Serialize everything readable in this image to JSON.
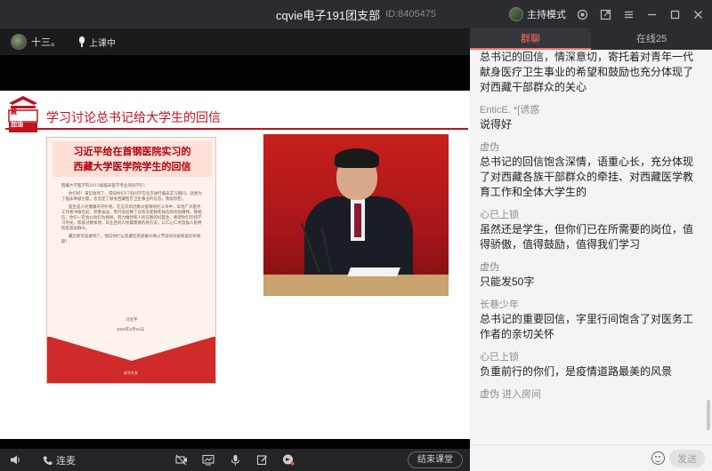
{
  "window": {
    "title": "cqvie电子191团支部",
    "room_id": "ID:8405475",
    "mode_label": "主持模式"
  },
  "stage": {
    "host_name": "十三。",
    "class_status": "上课中"
  },
  "slide": {
    "title": "学习讨论总书记给大学生的回信",
    "logo_text": "藏加油",
    "letter_heading_line1": "习近平给在首钢医院实习的",
    "letter_heading_line2": "西藏大学医学院学生的回信",
    "letter_salutation": "西藏大学医学院2015级临床医学专业的同学们：",
    "letter_paragraphs": [
      "你们好！来信收到了，得知你们17名同学在北京进行临床实习期间，就想为了临床奉献力量，也坚定了献身西藏医疗卫生事业的信念，我很欣慰。",
      "医生是人民健康的守护者。在这次新冠肺炎疫情防控斗争中，军地广大医务工作者冲锋在前、英勇奋战，用行动诠释了白衣天使救死扶伤的崇高精神。我相信，你们一定会以他们为榜样，努力做党和人民信赖的好医生。希望你们珍惜学习时光，练就过硬本领，毕业后到人民最需要的地方去，以仁心仁术造福人民特别是基层群众。",
      "藏历新年就要到了，我向你们以及藏区各族群众致以节日的问候和美好的祝愿！"
    ],
    "letter_signature": "习近平",
    "letter_date": "2020年2月21日",
    "letter_seal": "新华社发"
  },
  "toolbar": {
    "connect_label": "连麦",
    "end_class_label": "结束课堂"
  },
  "panel": {
    "tabs": [
      {
        "label": "群聊"
      },
      {
        "label": "在线25"
      }
    ],
    "messages": [
      {
        "name": "",
        "text": "总书记的回信，情深意切，寄托着对青年一代献身医疗卫生事业的希望和鼓励也充分体现了对西藏干部群众的关心"
      },
      {
        "name": "EnticE. *[诱惑",
        "text": "说得好"
      },
      {
        "name": "虚伪",
        "text": "总书记的回信饱含深情，语重心长，充分体现了对西藏各族干部群众的牵挂、对西藏医学教育工作和全体大学生的"
      },
      {
        "name": "心已上锁",
        "text": "虽然还是学生，但你们已在所需要的岗位，值得骄傲，值得鼓励，值得我们学习"
      },
      {
        "name": "虚伪",
        "text": "只能发50字"
      },
      {
        "name": "长巷少年",
        "text": "总书记的重要回信，字里行间饱含了对医务工作者的亲切关怀"
      },
      {
        "name": "心已上锁",
        "text": "负重前行的你们，是疫情道路最美的风景"
      }
    ],
    "join_note_name": "虚伪",
    "join_note_action": "进入房间",
    "input_placeholder": "",
    "send_label": "发送"
  },
  "colors": {
    "accent": "#ff6b5b",
    "slide_red": "#c1121f"
  }
}
